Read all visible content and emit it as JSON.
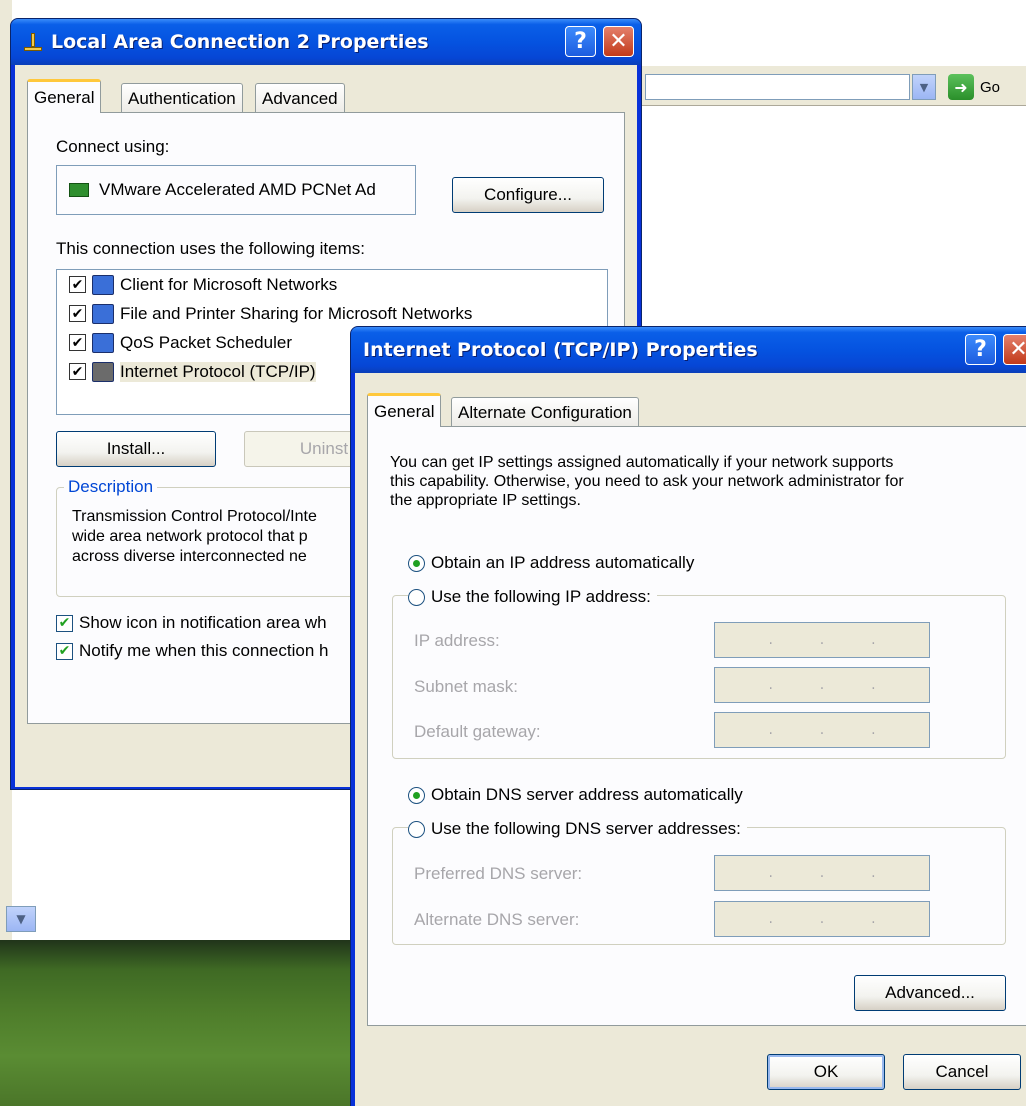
{
  "explorer": {
    "go_label": "Go"
  },
  "lac_window": {
    "title": "Local Area Connection 2 Properties",
    "tabs": [
      "General",
      "Authentication",
      "Advanced"
    ],
    "connect_using_label": "Connect using:",
    "adapter_name": "VMware Accelerated AMD PCNet Ad",
    "configure_label": "Configure...",
    "items_label": "This connection uses the following items:",
    "items": [
      {
        "label": "Client for Microsoft Networks",
        "checked": true,
        "icon": "network-client-icon"
      },
      {
        "label": "File and Printer Sharing for Microsoft Networks",
        "checked": true,
        "icon": "file-sharing-icon"
      },
      {
        "label": "QoS Packet Scheduler",
        "checked": true,
        "icon": "qos-scheduler-icon"
      },
      {
        "label": "Internet Protocol (TCP/IP)",
        "checked": true,
        "icon": "protocol-icon"
      }
    ],
    "install_label": "Install...",
    "uninstall_label": "Uninst",
    "description_label": "Description",
    "description_text": [
      "Transmission Control Protocol/Inte",
      "wide area network protocol that p",
      "across diverse interconnected ne"
    ],
    "show_icon_label": "Show icon in notification area wh",
    "notify_label": "Notify me when this connection h"
  },
  "tcpip_window": {
    "title": "Internet Protocol (TCP/IP) Properties",
    "tabs": [
      "General",
      "Alternate Configuration"
    ],
    "intro": [
      "You can get IP settings assigned automatically if your network supports",
      "this capability. Otherwise, you need to ask your network administrator for",
      "the appropriate IP settings."
    ],
    "obtain_ip_label": "Obtain an IP address automatically",
    "use_ip_label": "Use the following IP address:",
    "ip_address_label": "IP address:",
    "subnet_mask_label": "Subnet mask:",
    "default_gateway_label": "Default gateway:",
    "obtain_dns_label": "Obtain DNS server address automatically",
    "use_dns_label": "Use the following DNS server addresses:",
    "preferred_dns_label": "Preferred DNS server:",
    "alternate_dns_label": "Alternate DNS server:",
    "advanced_label": "Advanced...",
    "ok_label": "OK",
    "cancel_label": "Cancel",
    "ip_dot": "."
  }
}
